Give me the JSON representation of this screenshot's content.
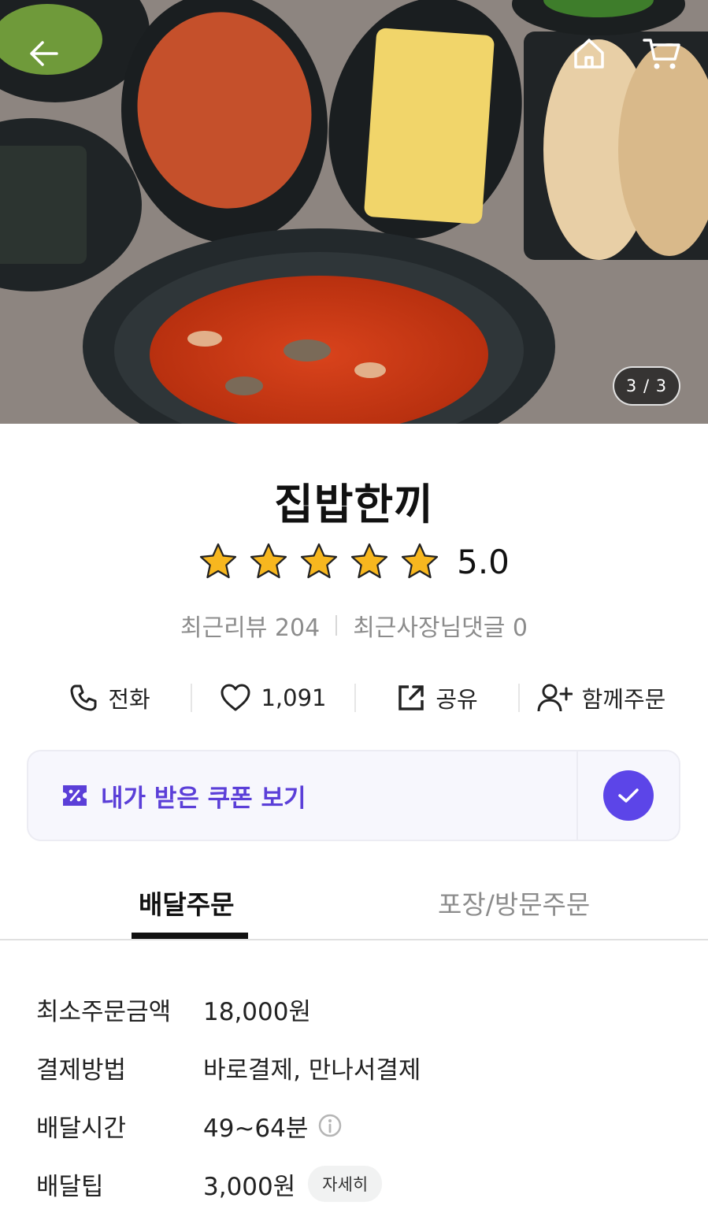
{
  "hero": {
    "pager_text": "3 / 3",
    "icons": [
      "back-arrow-icon",
      "home-icon",
      "cart-icon"
    ]
  },
  "store": {
    "name": "집밥한끼",
    "rating": "5.0",
    "stars": 5,
    "reviews_label": "최근리뷰 204",
    "owner_replies_label": "최근사장님댓글 0"
  },
  "actions": [
    {
      "label": "전화",
      "icon": "phone-icon"
    },
    {
      "label": "1,091",
      "icon": "heart-icon"
    },
    {
      "label": "공유",
      "icon": "share-icon"
    },
    {
      "label": "함께주문",
      "icon": "add-person-icon"
    }
  ],
  "coupon": {
    "label": "내가 받은 쿠폰 보기",
    "accent": "#5c45e8"
  },
  "tabs": {
    "delivery": "배달주문",
    "pickup": "포장/방문주문",
    "active": "delivery"
  },
  "info": {
    "min_order_key": "최소주문금액",
    "min_order_val": "18,000원",
    "payment_key": "결제방법",
    "payment_val": "바로결제, 만나서결제",
    "delivery_time_key": "배달시간",
    "delivery_time_val": "49~64분",
    "delivery_tip_key": "배달팁",
    "delivery_tip_val": "3,000원",
    "detail_label": "자세히"
  }
}
